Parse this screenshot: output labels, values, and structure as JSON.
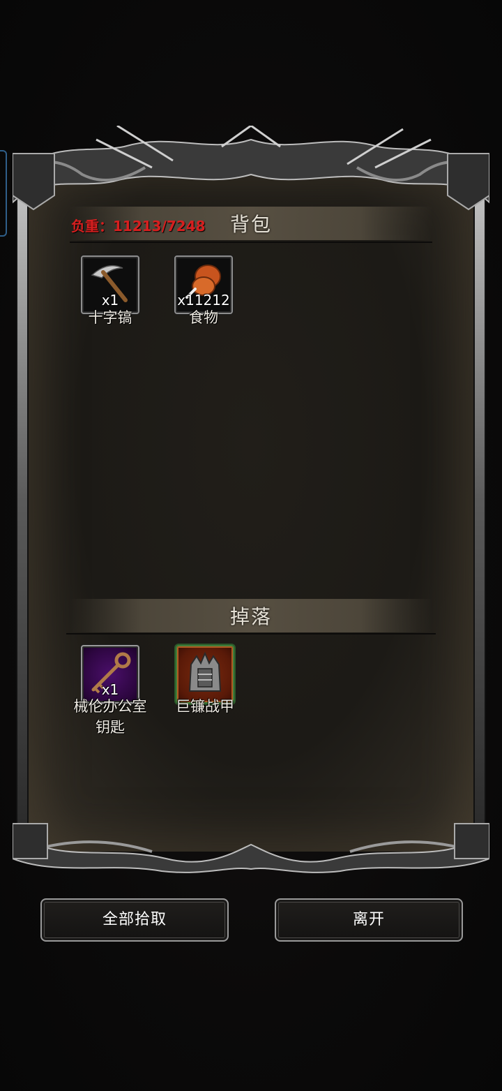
{
  "weight_label": "负重：11213/7248",
  "backpack": {
    "title": "背包",
    "items": [
      {
        "icon": "pickaxe-icon",
        "qty": "x1",
        "name": "十字镐"
      },
      {
        "icon": "food-drumstick-icon",
        "qty": "x11212",
        "name": "食物"
      }
    ]
  },
  "drops": {
    "title": "掉落",
    "items": [
      {
        "icon": "key-icon",
        "qty": "x1",
        "name_line1": "械伦办公室",
        "name_line2": "钥匙",
        "rarity_color": "#4a0f6a"
      },
      {
        "icon": "spiked-armor-icon",
        "qty": "",
        "name_line1": "巨镰战甲",
        "name_line2": "",
        "rarity_color": "#7a2a0e"
      }
    ]
  },
  "buttons": {
    "pick_all": "全部拾取",
    "leave": "离开"
  },
  "colors": {
    "weight_text": "#d61f1f",
    "panel_bg": "#1c1a16"
  }
}
